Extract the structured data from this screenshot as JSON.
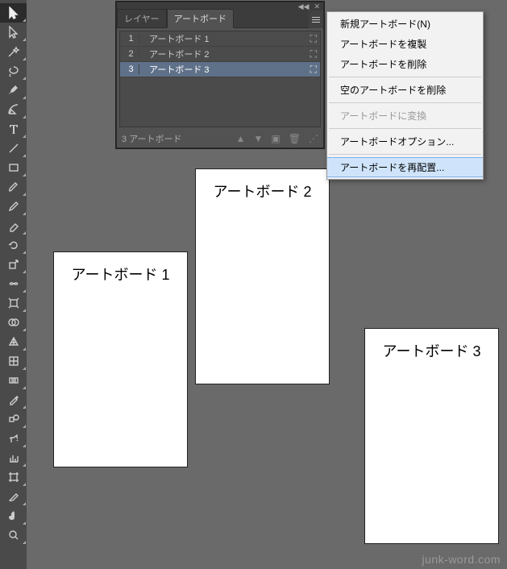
{
  "toolbar": {
    "tools": [
      "selection",
      "direct-selection",
      "magic-wand",
      "lasso",
      "pen",
      "curvature",
      "type",
      "line",
      "rectangle",
      "brush",
      "pencil",
      "eraser",
      "rotate",
      "scale",
      "width",
      "free-transform",
      "shape-builder",
      "perspective",
      "mesh",
      "gradient",
      "eyedropper",
      "blend",
      "symbol-sprayer",
      "graph",
      "artboard",
      "slice",
      "hand",
      "zoom"
    ]
  },
  "panel": {
    "tabs": {
      "layers": "レイヤー",
      "artboards": "アートボード"
    },
    "rows": [
      {
        "num": "1",
        "name": "アートボード 1"
      },
      {
        "num": "2",
        "name": "アートボード  2"
      },
      {
        "num": "3",
        "name": "アートボード  3"
      }
    ],
    "footer": "3 アートボード"
  },
  "contextMenu": {
    "newArtboard": "新規アートボード(N)",
    "duplicate": "アートボードを複製",
    "delete": "アートボードを削除",
    "deleteEmpty": "空のアートボードを削除",
    "convert": "アートボードに変換",
    "options": "アートボードオプション...",
    "rearrange": "アートボードを再配置..."
  },
  "canvas": {
    "ab1": "アートボード 1",
    "ab2": "アートボード 2",
    "ab3": "アートボード 3"
  },
  "watermark": "junk-word.com"
}
